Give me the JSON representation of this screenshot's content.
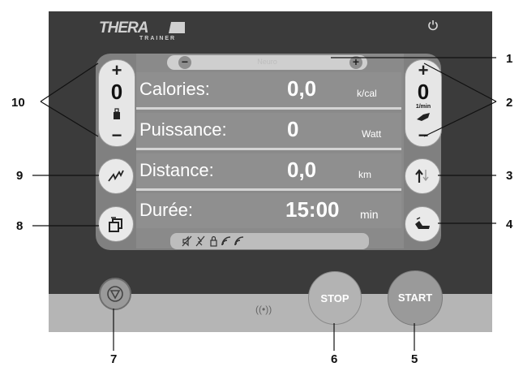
{
  "device": {
    "brand": "THERA",
    "brand_sub": "TRAINER",
    "power_icon": "power-icon"
  },
  "neuro": {
    "label": "Neuro",
    "minus": "−",
    "plus": "+"
  },
  "readings": [
    {
      "label": "Calories:",
      "value": "0,0",
      "unit": "k/cal"
    },
    {
      "label": "Puissance:",
      "value": "0",
      "unit": "Watt"
    },
    {
      "label": "Distance:",
      "value": "0,0",
      "unit": "km"
    },
    {
      "label": "Durée:",
      "value": "15:00",
      "unit": "min"
    }
  ],
  "left_stepper": {
    "plus": "+",
    "value": "0",
    "minus": "−",
    "icon": "weight-icon"
  },
  "right_stepper": {
    "plus": "+",
    "value": "0",
    "unit": "1/min",
    "minus": "−",
    "icon": "pedal-icon"
  },
  "buttons": {
    "stop": "STOP",
    "start": "START",
    "signal": "((•))"
  },
  "status_icons": [
    "no-sound-icon",
    "no-spasm-icon",
    "lock-icon",
    "signal-icon",
    "wifi-icon"
  ],
  "callouts": {
    "c1": "1",
    "c2": "2",
    "c3": "3",
    "c4": "4",
    "c5": "5",
    "c6": "6",
    "c7": "7",
    "c8": "8",
    "c9": "9",
    "c10": "10"
  },
  "colors": {
    "device": "#3b3b3b",
    "screen": "#808080",
    "panel": "#b5b5b5"
  }
}
